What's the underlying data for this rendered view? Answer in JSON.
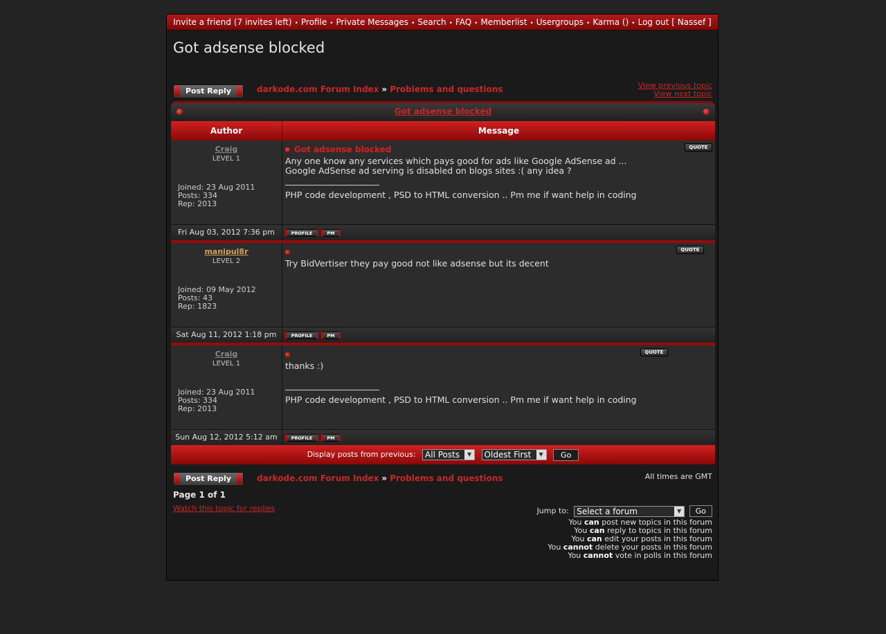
{
  "nav": {
    "invite": "Invite a friend (7 invites left)",
    "profile": "Profile",
    "pm": "Private Messages",
    "search": "Search",
    "faq": "FAQ",
    "memberlist": "Memberlist",
    "usergroups": "Usergroups",
    "karma": "Karma ()",
    "logout": "Log out [ Nassef ]",
    "separator": "•"
  },
  "topic_title": "Got adsense blocked",
  "post_reply_label": "Post Reply",
  "breadcrumb": {
    "index": "darkode.com Forum Index",
    "separator": "»",
    "forum": "Problems and questions"
  },
  "view_previous": "View previous topic",
  "view_next": "View next topic",
  "columns": {
    "author": "Author",
    "message": "Message"
  },
  "quote_label": "QUOTE",
  "profile_label": "PROFILE",
  "pm_label": "PM",
  "posts": [
    {
      "author": "Craig",
      "author_color": "#8a8a8a",
      "level": "LEVEL 1",
      "joined": "Joined: 23 Aug 2011",
      "posts": "Posts: 334",
      "rep": "Rep: 2013",
      "subject": "Got adsense blocked",
      "text": "Any one know any services which pays good for ads like Google AdSense ad ...\nGoogle AdSense ad serving is disabled on blogs sites :( any idea ?",
      "signature": "PHP code development , PSD to HTML conversion .. Pm me if want help in coding",
      "date": "Fri Aug 03, 2012 7:36 pm"
    },
    {
      "author": "manipul8r",
      "author_color": "#d4a060",
      "level": "LEVEL 2",
      "joined": "Joined: 09 May 2012",
      "posts": "Posts: 43",
      "rep": "Rep: 1823",
      "subject": "",
      "text": "Try BidVertiser they pay good not like adsense but its decent",
      "signature": "",
      "date": "Sat Aug 11, 2012 1:18 pm"
    },
    {
      "author": "Craig",
      "author_color": "#8a8a8a",
      "level": "LEVEL 1",
      "joined": "Joined: 23 Aug 2011",
      "posts": "Posts: 334",
      "rep": "Rep: 2013",
      "subject": "",
      "text": "thanks :)",
      "signature": "PHP code development , PSD to HTML conversion .. Pm me if want help in coding",
      "date": "Sun Aug 12, 2012 5:12 am"
    }
  ],
  "display_bar": {
    "label": "Display posts from previous:",
    "range_value": "All Posts",
    "order_value": "Oldest First",
    "go": "Go"
  },
  "times_gmt": "All times are GMT",
  "page_info": "Page 1 of 1",
  "watch_topic": "Watch this topic for replies",
  "jump": {
    "label": "Jump to:",
    "value": "Select a forum",
    "go": "Go"
  },
  "permissions": [
    {
      "pre": "You ",
      "key": "can",
      "post": " post new topics in this forum"
    },
    {
      "pre": "You ",
      "key": "can",
      "post": " reply to topics in this forum"
    },
    {
      "pre": "You ",
      "key": "can",
      "post": " edit your posts in this forum"
    },
    {
      "pre": "You ",
      "key": "cannot",
      "post": " delete your posts in this forum"
    },
    {
      "pre": "You ",
      "key": "cannot",
      "post": " vote in polls in this forum"
    }
  ],
  "colors": {
    "accent": "#c62828",
    "nav_bg": "#9a1010",
    "page_bg": "#1a1a1a"
  }
}
